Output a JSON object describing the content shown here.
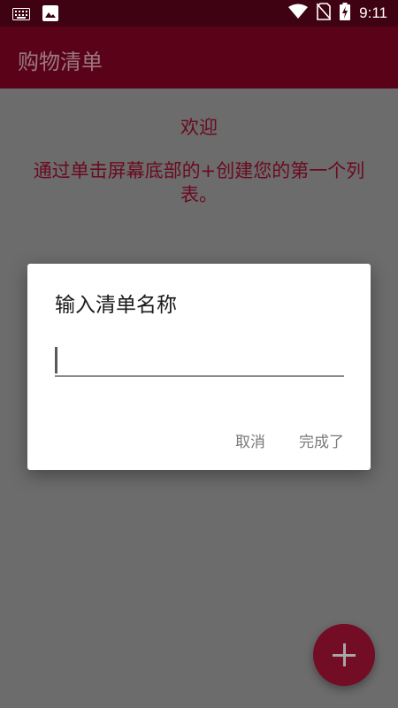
{
  "status_bar": {
    "time": "9:11",
    "icons": [
      "keyboard-icon",
      "image-icon",
      "wifi-icon",
      "no-sim-icon",
      "battery-charging-icon"
    ]
  },
  "app_bar": {
    "title": "购物清单"
  },
  "content": {
    "welcome": "欢迎",
    "hint": "通过单击屏幕底部的+创建您的第一个列表。"
  },
  "dialog": {
    "title": "输入清单名称",
    "input_value": "",
    "cancel_label": "取消",
    "done_label": "完成了"
  },
  "fab": {
    "icon": "plus-icon"
  },
  "colors": {
    "status_bar": "#3e0212",
    "app_bar": "#5a0217",
    "accent": "#730c25",
    "scrim_background": "#6c6c6c"
  }
}
